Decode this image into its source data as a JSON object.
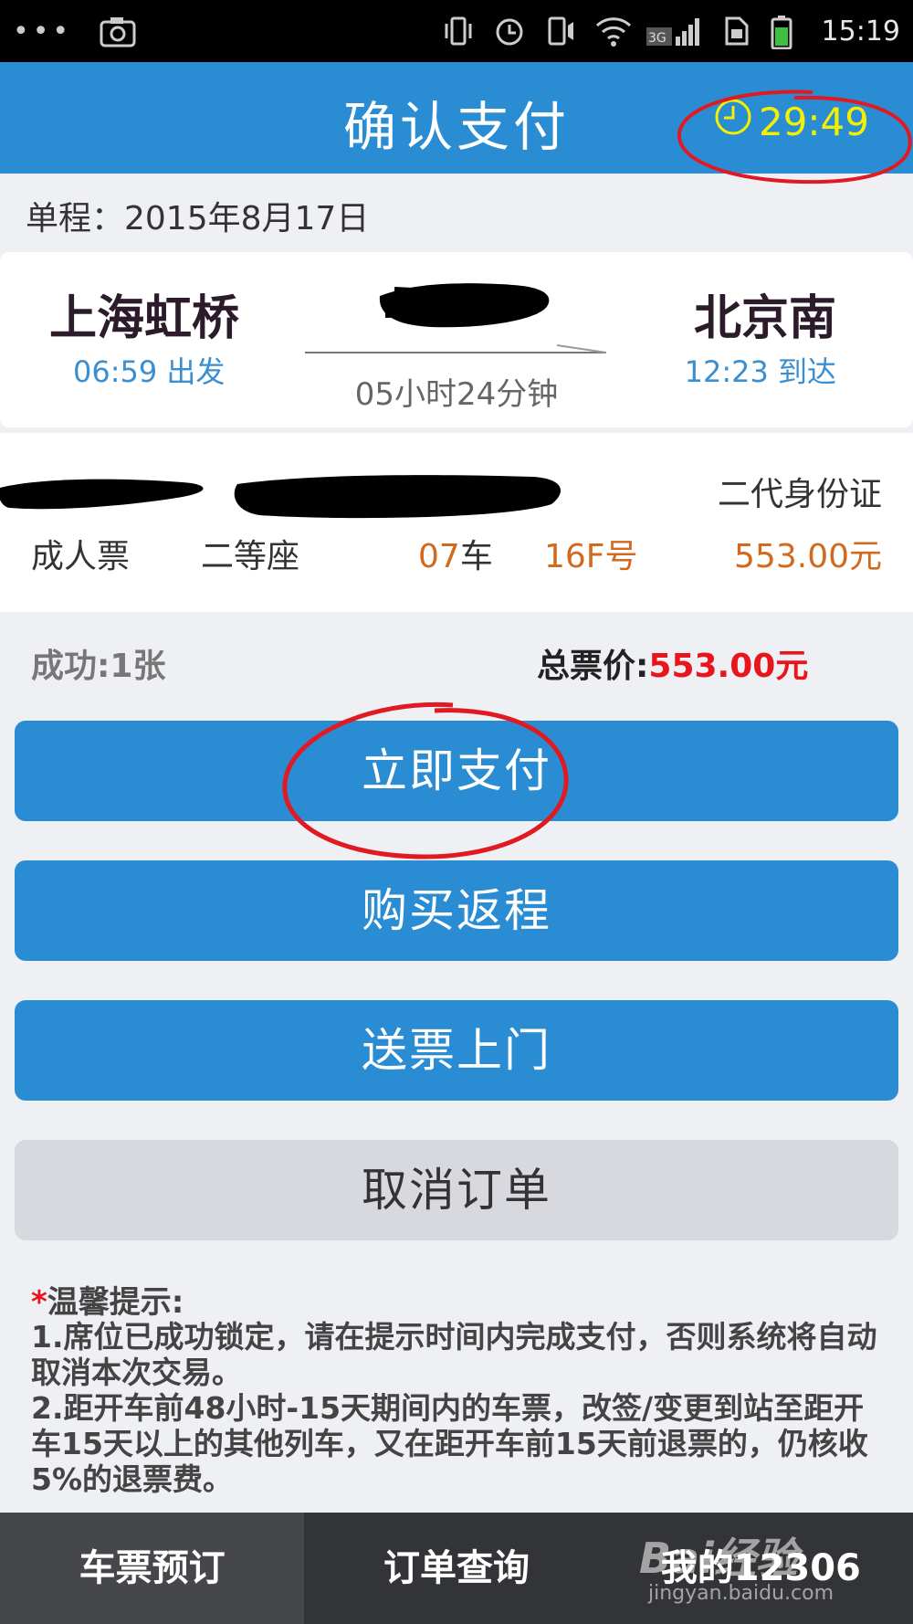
{
  "status_bar": {
    "time": "15:19",
    "network": "3G",
    "icons": [
      "camera-icon",
      "vibrate-icon",
      "alarm-icon",
      "call-icon",
      "wifi-icon",
      "signal-icon",
      "sim-icon",
      "battery-icon"
    ]
  },
  "header": {
    "title": "确认支付",
    "timer": "29:49",
    "timer_icon": "clock-icon",
    "accent": "#2a8dd4",
    "timer_color": "#f3f000"
  },
  "trip": {
    "date_label": "单程：2015年8月17日",
    "from_station": "上海虹桥",
    "from_time": "06:59 出发",
    "to_station": "北京南",
    "to_time": "12:23 到达",
    "duration": "05小时24分钟"
  },
  "passenger": {
    "id_type": "二代身份证",
    "ticket_type": "成人票",
    "seat_class": "二等座",
    "car_number": "07",
    "car_suffix": "车",
    "seat_number": "16F号",
    "price": "553.00元"
  },
  "summary": {
    "success": "成功:1张",
    "total_label": "总票价:",
    "total_value": "553.00元"
  },
  "buttons": {
    "pay": "立即支付",
    "return_trip": "购买返程",
    "delivery": "送票上门",
    "cancel": "取消订单"
  },
  "tips": {
    "star": "*",
    "title": "温馨提示:",
    "text": "1.席位已成功锁定，请在提示时间内完成支付，否则系统将自动取消本次交易。\n2.距开车前48小时-15天期间内的车票，改签/变更到站至距开车15天以上的其他列车，又在距开车前15天前退票的，仍核收5%的退票费。"
  },
  "tabs": [
    {
      "label": "车票预订",
      "active": true
    },
    {
      "label": "订单查询",
      "active": false
    },
    {
      "label": "我的12306",
      "active": false
    }
  ],
  "watermark": {
    "brand": "Bai经验",
    "url": "jingyan.baidu.com"
  }
}
